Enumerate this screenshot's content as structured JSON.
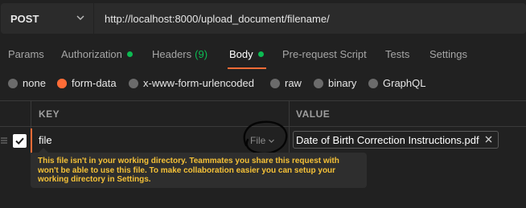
{
  "request": {
    "method": "POST",
    "url": "http://localhost:8000/upload_document/filename/"
  },
  "tabs": [
    {
      "label": "Params",
      "indicator": null,
      "count": null,
      "active": false
    },
    {
      "label": "Authorization",
      "indicator": "green-dot",
      "count": null,
      "active": false
    },
    {
      "label": "Headers",
      "indicator": null,
      "count": "(9)",
      "active": false
    },
    {
      "label": "Body",
      "indicator": "green-dot",
      "count": null,
      "active": true
    },
    {
      "label": "Pre-request Script",
      "indicator": null,
      "count": null,
      "active": false
    },
    {
      "label": "Tests",
      "indicator": null,
      "count": null,
      "active": false
    },
    {
      "label": "Settings",
      "indicator": null,
      "count": null,
      "active": false
    }
  ],
  "body_types": [
    {
      "label": "none",
      "selected": false
    },
    {
      "label": "form-data",
      "selected": true
    },
    {
      "label": "x-www-form-urlencoded",
      "selected": false
    },
    {
      "label": "raw",
      "selected": false
    },
    {
      "label": "binary",
      "selected": false
    },
    {
      "label": "GraphQL",
      "selected": false
    }
  ],
  "table": {
    "key_header": "KEY",
    "value_header": "VALUE",
    "rows": [
      {
        "checked": true,
        "key": "file",
        "type": "File",
        "value": "Date of Birth Correction Instructions.pdf"
      }
    ]
  },
  "tooltip": {
    "lines": [
      "This file isn't in your working directory. Teammates you share this request with",
      "won't be able to use this file. To make collaboration easier you can setup your",
      "working directory in Settings."
    ]
  },
  "colors": {
    "accent": "#ff6c37",
    "success": "#0cbb52",
    "warning_text": "#f5c137",
    "background": "#212121"
  }
}
